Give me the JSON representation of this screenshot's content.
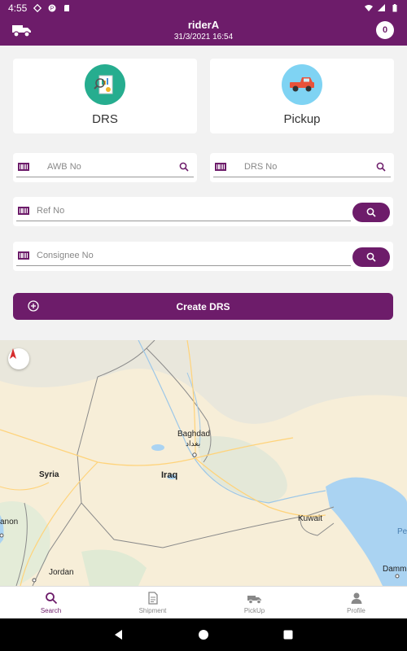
{
  "status_bar": {
    "time": "4:55"
  },
  "appbar": {
    "title": "riderA",
    "subtitle": "31/3/2021 16:54",
    "badge_count": "0"
  },
  "tiles": [
    {
      "label": "DRS",
      "icon": "drs-report-icon"
    },
    {
      "label": "Pickup",
      "icon": "pickup-truck-icon"
    }
  ],
  "fields": {
    "awb": {
      "placeholder": "AWB No",
      "value": ""
    },
    "drs": {
      "placeholder": "DRS No",
      "value": ""
    },
    "ref": {
      "placeholder": "Ref No",
      "value": ""
    },
    "consignee": {
      "placeholder": "Consignee No",
      "value": ""
    }
  },
  "create_button": {
    "label": "Create DRS"
  },
  "map": {
    "labels": {
      "baghdad": "Baghdad",
      "baghdad_ar": "بغداد",
      "syria": "Syria",
      "iraq": "Iraq",
      "kuwait": "Kuwait",
      "lebanon": "anon",
      "jordan": "Jordan",
      "dammam": "Damm",
      "pe": "Pe"
    }
  },
  "bottom_nav": [
    {
      "label": "Search",
      "icon": "search-icon"
    },
    {
      "label": "Shipment",
      "icon": "document-icon"
    },
    {
      "label": "PickUp",
      "icon": "truck-icon"
    },
    {
      "label": "Profile",
      "icon": "person-icon"
    }
  ],
  "colors": {
    "primary": "#6d1c6a",
    "drs_tile": "#26ad8f",
    "pickup_tile": "#7fd3f3"
  }
}
